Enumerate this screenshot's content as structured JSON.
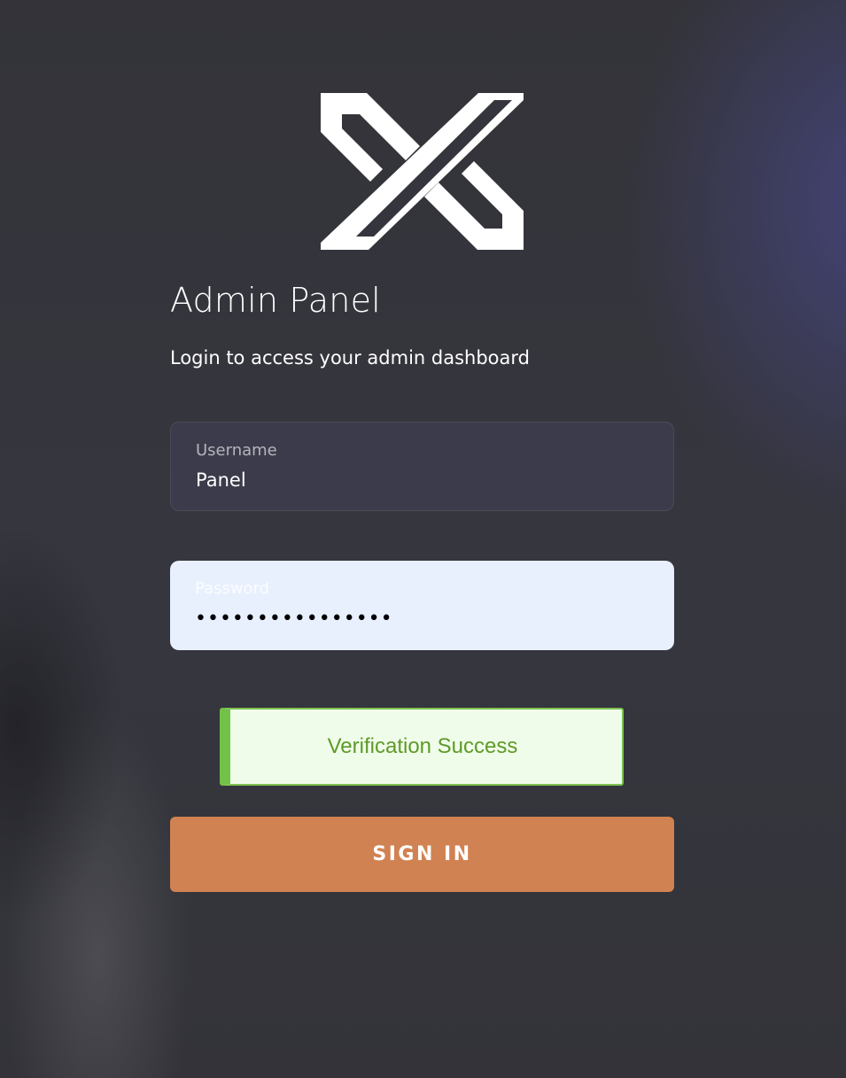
{
  "login": {
    "title": "Admin Panel",
    "subtitle": "Login to access your admin dashboard",
    "username": {
      "label": "Username",
      "value": "Panel"
    },
    "password": {
      "label": "Password",
      "value": "••••••••••••••••"
    },
    "verification": {
      "text": "Verification Success",
      "status_color": "#72c24a"
    },
    "submit_label": "SIGN IN"
  },
  "icons": {
    "logo": "x-logo-icon"
  },
  "colors": {
    "accent": "#d18252",
    "success_text": "#5e9a28",
    "autofill_bg": "#e8f0fe"
  }
}
